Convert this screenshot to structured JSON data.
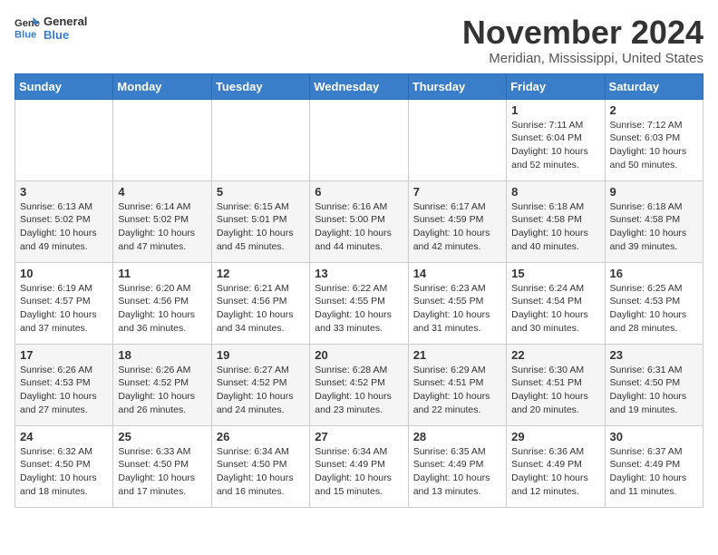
{
  "header": {
    "logo_general": "General",
    "logo_blue": "Blue",
    "month_title": "November 2024",
    "location": "Meridian, Mississippi, United States"
  },
  "days_of_week": [
    "Sunday",
    "Monday",
    "Tuesday",
    "Wednesday",
    "Thursday",
    "Friday",
    "Saturday"
  ],
  "weeks": [
    [
      {
        "day": "",
        "info": ""
      },
      {
        "day": "",
        "info": ""
      },
      {
        "day": "",
        "info": ""
      },
      {
        "day": "",
        "info": ""
      },
      {
        "day": "",
        "info": ""
      },
      {
        "day": "1",
        "info": "Sunrise: 7:11 AM\nSunset: 6:04 PM\nDaylight: 10 hours\nand 52 minutes."
      },
      {
        "day": "2",
        "info": "Sunrise: 7:12 AM\nSunset: 6:03 PM\nDaylight: 10 hours\nand 50 minutes."
      }
    ],
    [
      {
        "day": "3",
        "info": "Sunrise: 6:13 AM\nSunset: 5:02 PM\nDaylight: 10 hours\nand 49 minutes."
      },
      {
        "day": "4",
        "info": "Sunrise: 6:14 AM\nSunset: 5:02 PM\nDaylight: 10 hours\nand 47 minutes."
      },
      {
        "day": "5",
        "info": "Sunrise: 6:15 AM\nSunset: 5:01 PM\nDaylight: 10 hours\nand 45 minutes."
      },
      {
        "day": "6",
        "info": "Sunrise: 6:16 AM\nSunset: 5:00 PM\nDaylight: 10 hours\nand 44 minutes."
      },
      {
        "day": "7",
        "info": "Sunrise: 6:17 AM\nSunset: 4:59 PM\nDaylight: 10 hours\nand 42 minutes."
      },
      {
        "day": "8",
        "info": "Sunrise: 6:18 AM\nSunset: 4:58 PM\nDaylight: 10 hours\nand 40 minutes."
      },
      {
        "day": "9",
        "info": "Sunrise: 6:18 AM\nSunset: 4:58 PM\nDaylight: 10 hours\nand 39 minutes."
      }
    ],
    [
      {
        "day": "10",
        "info": "Sunrise: 6:19 AM\nSunset: 4:57 PM\nDaylight: 10 hours\nand 37 minutes."
      },
      {
        "day": "11",
        "info": "Sunrise: 6:20 AM\nSunset: 4:56 PM\nDaylight: 10 hours\nand 36 minutes."
      },
      {
        "day": "12",
        "info": "Sunrise: 6:21 AM\nSunset: 4:56 PM\nDaylight: 10 hours\nand 34 minutes."
      },
      {
        "day": "13",
        "info": "Sunrise: 6:22 AM\nSunset: 4:55 PM\nDaylight: 10 hours\nand 33 minutes."
      },
      {
        "day": "14",
        "info": "Sunrise: 6:23 AM\nSunset: 4:55 PM\nDaylight: 10 hours\nand 31 minutes."
      },
      {
        "day": "15",
        "info": "Sunrise: 6:24 AM\nSunset: 4:54 PM\nDaylight: 10 hours\nand 30 minutes."
      },
      {
        "day": "16",
        "info": "Sunrise: 6:25 AM\nSunset: 4:53 PM\nDaylight: 10 hours\nand 28 minutes."
      }
    ],
    [
      {
        "day": "17",
        "info": "Sunrise: 6:26 AM\nSunset: 4:53 PM\nDaylight: 10 hours\nand 27 minutes."
      },
      {
        "day": "18",
        "info": "Sunrise: 6:26 AM\nSunset: 4:52 PM\nDaylight: 10 hours\nand 26 minutes."
      },
      {
        "day": "19",
        "info": "Sunrise: 6:27 AM\nSunset: 4:52 PM\nDaylight: 10 hours\nand 24 minutes."
      },
      {
        "day": "20",
        "info": "Sunrise: 6:28 AM\nSunset: 4:52 PM\nDaylight: 10 hours\nand 23 minutes."
      },
      {
        "day": "21",
        "info": "Sunrise: 6:29 AM\nSunset: 4:51 PM\nDaylight: 10 hours\nand 22 minutes."
      },
      {
        "day": "22",
        "info": "Sunrise: 6:30 AM\nSunset: 4:51 PM\nDaylight: 10 hours\nand 20 minutes."
      },
      {
        "day": "23",
        "info": "Sunrise: 6:31 AM\nSunset: 4:50 PM\nDaylight: 10 hours\nand 19 minutes."
      }
    ],
    [
      {
        "day": "24",
        "info": "Sunrise: 6:32 AM\nSunset: 4:50 PM\nDaylight: 10 hours\nand 18 minutes."
      },
      {
        "day": "25",
        "info": "Sunrise: 6:33 AM\nSunset: 4:50 PM\nDaylight: 10 hours\nand 17 minutes."
      },
      {
        "day": "26",
        "info": "Sunrise: 6:34 AM\nSunset: 4:50 PM\nDaylight: 10 hours\nand 16 minutes."
      },
      {
        "day": "27",
        "info": "Sunrise: 6:34 AM\nSunset: 4:49 PM\nDaylight: 10 hours\nand 15 minutes."
      },
      {
        "day": "28",
        "info": "Sunrise: 6:35 AM\nSunset: 4:49 PM\nDaylight: 10 hours\nand 13 minutes."
      },
      {
        "day": "29",
        "info": "Sunrise: 6:36 AM\nSunset: 4:49 PM\nDaylight: 10 hours\nand 12 minutes."
      },
      {
        "day": "30",
        "info": "Sunrise: 6:37 AM\nSunset: 4:49 PM\nDaylight: 10 hours\nand 11 minutes."
      }
    ]
  ]
}
